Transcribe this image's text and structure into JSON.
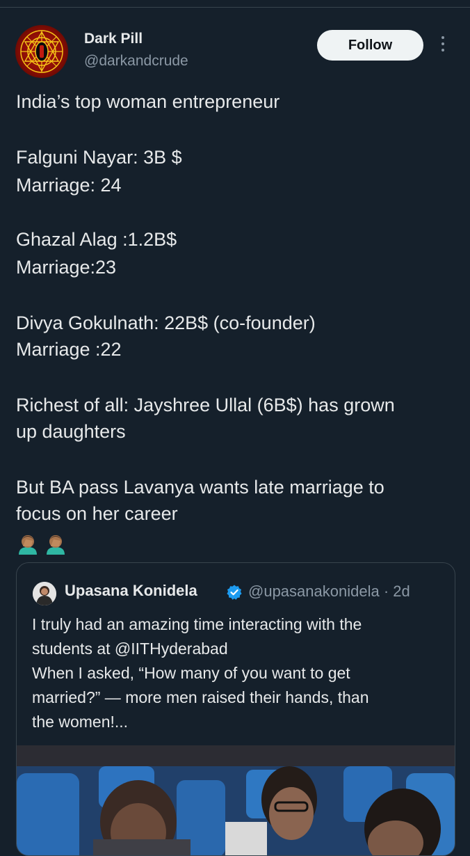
{
  "author": {
    "display_name": "Dark Pill",
    "handle": "@darkandcrude",
    "follow_label": "Follow"
  },
  "tweet": {
    "lines": [
      "India’s top woman entrepreneur",
      "Falguni Nayar: 3B $",
      "Marriage: 24",
      "Ghazal Alag :1.2B$",
      "Marriage:23",
      "Divya Gokulnath: 22B$ (co-founder)",
      "Marriage :22",
      "Richest of all: Jayshree Ullal (6B$) has grown",
      "up daughters",
      "But BA pass Lavanya wants late marriage to",
      "focus on her career"
    ],
    "emoji": "🤦🏽‍♂️🤦🏽‍♂️"
  },
  "quote": {
    "display_name": "Upasana Konidela",
    "handle": "@upasanakonidela",
    "time": "· 2d",
    "lines": [
      "I truly had an amazing time interacting with the",
      "students at @IITHyderabad",
      "When I asked, “How many of you want to get",
      "married?” — more men raised their hands, than",
      "the women!..."
    ]
  },
  "colors": {
    "background": "#15202b",
    "text": "#e7e9ea",
    "muted": "#8b98a5",
    "verified": "#1d9bf0",
    "border": "#38444d"
  }
}
